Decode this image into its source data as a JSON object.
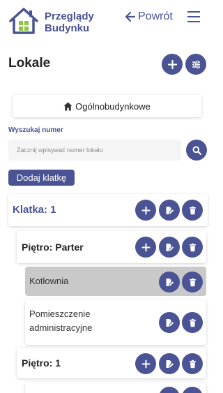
{
  "header": {
    "app_name_line1": "Przeglądy",
    "app_name_line2": "Budynku",
    "back_label": "Powrót",
    "logo_icon": "house-icon",
    "menu_icon": "hamburger-icon"
  },
  "page": {
    "title": "Lokale"
  },
  "general_button_label": "Ogólnobudynkowe",
  "search": {
    "label": "Wyszukaj numer",
    "placeholder": "Zacznij wpisywać numer lokalu"
  },
  "add_stairwell_label": "Dodaj klatkę",
  "structure": {
    "stairwell": "Klatka: 1",
    "floor_ground": "Piętro: Parter",
    "room_boiler": "Kotłownia",
    "room_admin": "Pomieszczenie administracyjne",
    "floor_1": "Piętro: 1"
  },
  "colors": {
    "accent": "#4a5394",
    "logo_green": "#8dc63f",
    "row_highlight": "#c9c9c9"
  }
}
